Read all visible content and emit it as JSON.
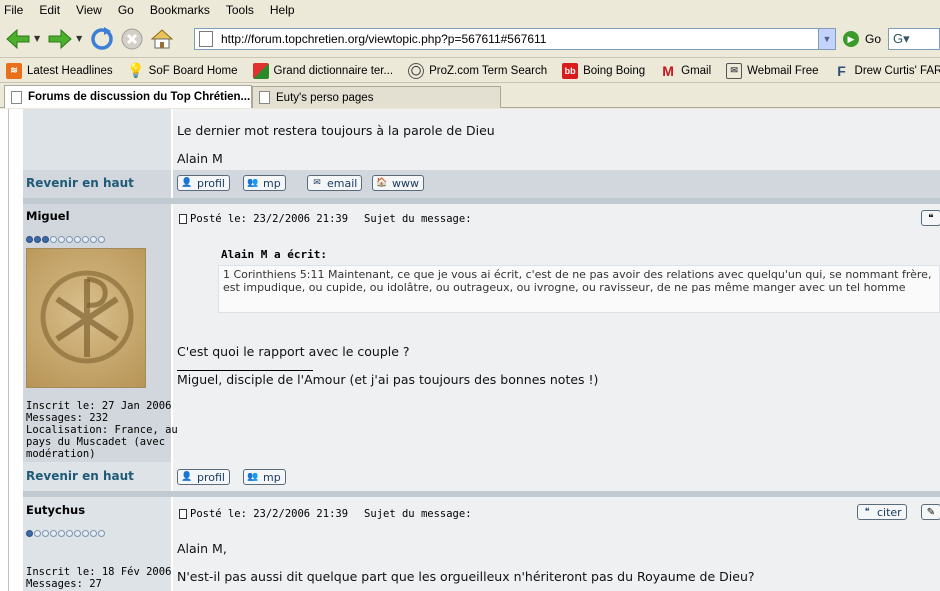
{
  "menu": [
    "File",
    "Edit",
    "View",
    "Go",
    "Bookmarks",
    "Tools",
    "Help"
  ],
  "address": {
    "url": "http://forum.topchretien.org/viewtopic.php?p=567611#567611",
    "go_label": "Go"
  },
  "bookmarks": [
    {
      "label": "Latest Headlines",
      "icon": "rss-icon"
    },
    {
      "label": "SoF Board Home",
      "icon": "lightbulb-icon"
    },
    {
      "label": "Grand dictionnaire ter...",
      "icon": "dictionary-icon"
    },
    {
      "label": "ProZ.com Term Search",
      "icon": "proz-icon"
    },
    {
      "label": "Boing Boing",
      "icon": "bb-icon"
    },
    {
      "label": "Gmail",
      "icon": "gmail-icon"
    },
    {
      "label": "Webmail Free",
      "icon": "mail-icon"
    },
    {
      "label": "Drew Curtis' FARK.com",
      "icon": "fark-icon"
    }
  ],
  "tabs": [
    {
      "label": "Forums de discussion du Top Chrétien...",
      "active": true
    },
    {
      "label": "Euty's perso pages",
      "active": false
    }
  ],
  "forum": {
    "post0": {
      "line1": "Le dernier mot restera toujours à la parole de Dieu",
      "line2": "Alain M"
    },
    "revenir": "Revenir en haut",
    "buttons": {
      "profil": "profil",
      "mp": "mp",
      "email": "email",
      "www": "www",
      "citer": "citer"
    },
    "post1": {
      "username": "Miguel",
      "rank_on": 3,
      "rank_total": 10,
      "posted": "Posté le: 23/2/2006 21:39",
      "subject": "Sujet du message:",
      "quote_author": "Alain M a écrit:",
      "quote_text": "1 Corinthiens 5:11 Maintenant, ce que je vous ai écrit, c'est de ne pas avoir des relations avec quelqu'un qui, se nommant frère, est impudique, ou cupide, ou idolâtre, ou outrageux, ou ivrogne, ou ravisseur, de ne pas même manger avec un tel homme",
      "body": "C'est quoi le rapport avec le couple ?",
      "signature": "Miguel, disciple de l'Amour (et j'ai pas toujours des bonnes notes !)",
      "meta": [
        "Inscrit le: 27 Jan 2006",
        "Messages: 232",
        "Localisation: France, au",
        "pays du Muscadet (avec",
        "modération)"
      ]
    },
    "post2": {
      "username": "Eutychus",
      "rank_on": 1,
      "rank_total": 10,
      "posted": "Posté le: 23/2/2006 21:39",
      "subject": "Sujet du message:",
      "line1": "Alain M,",
      "line2": "N'est-il pas aussi dit quelque part que les orgueilleux n'hériteront pas du Royaume de Dieu?",
      "meta": [
        "Inscrit le: 18 Fév 2006",
        "Messages: 27"
      ]
    }
  }
}
